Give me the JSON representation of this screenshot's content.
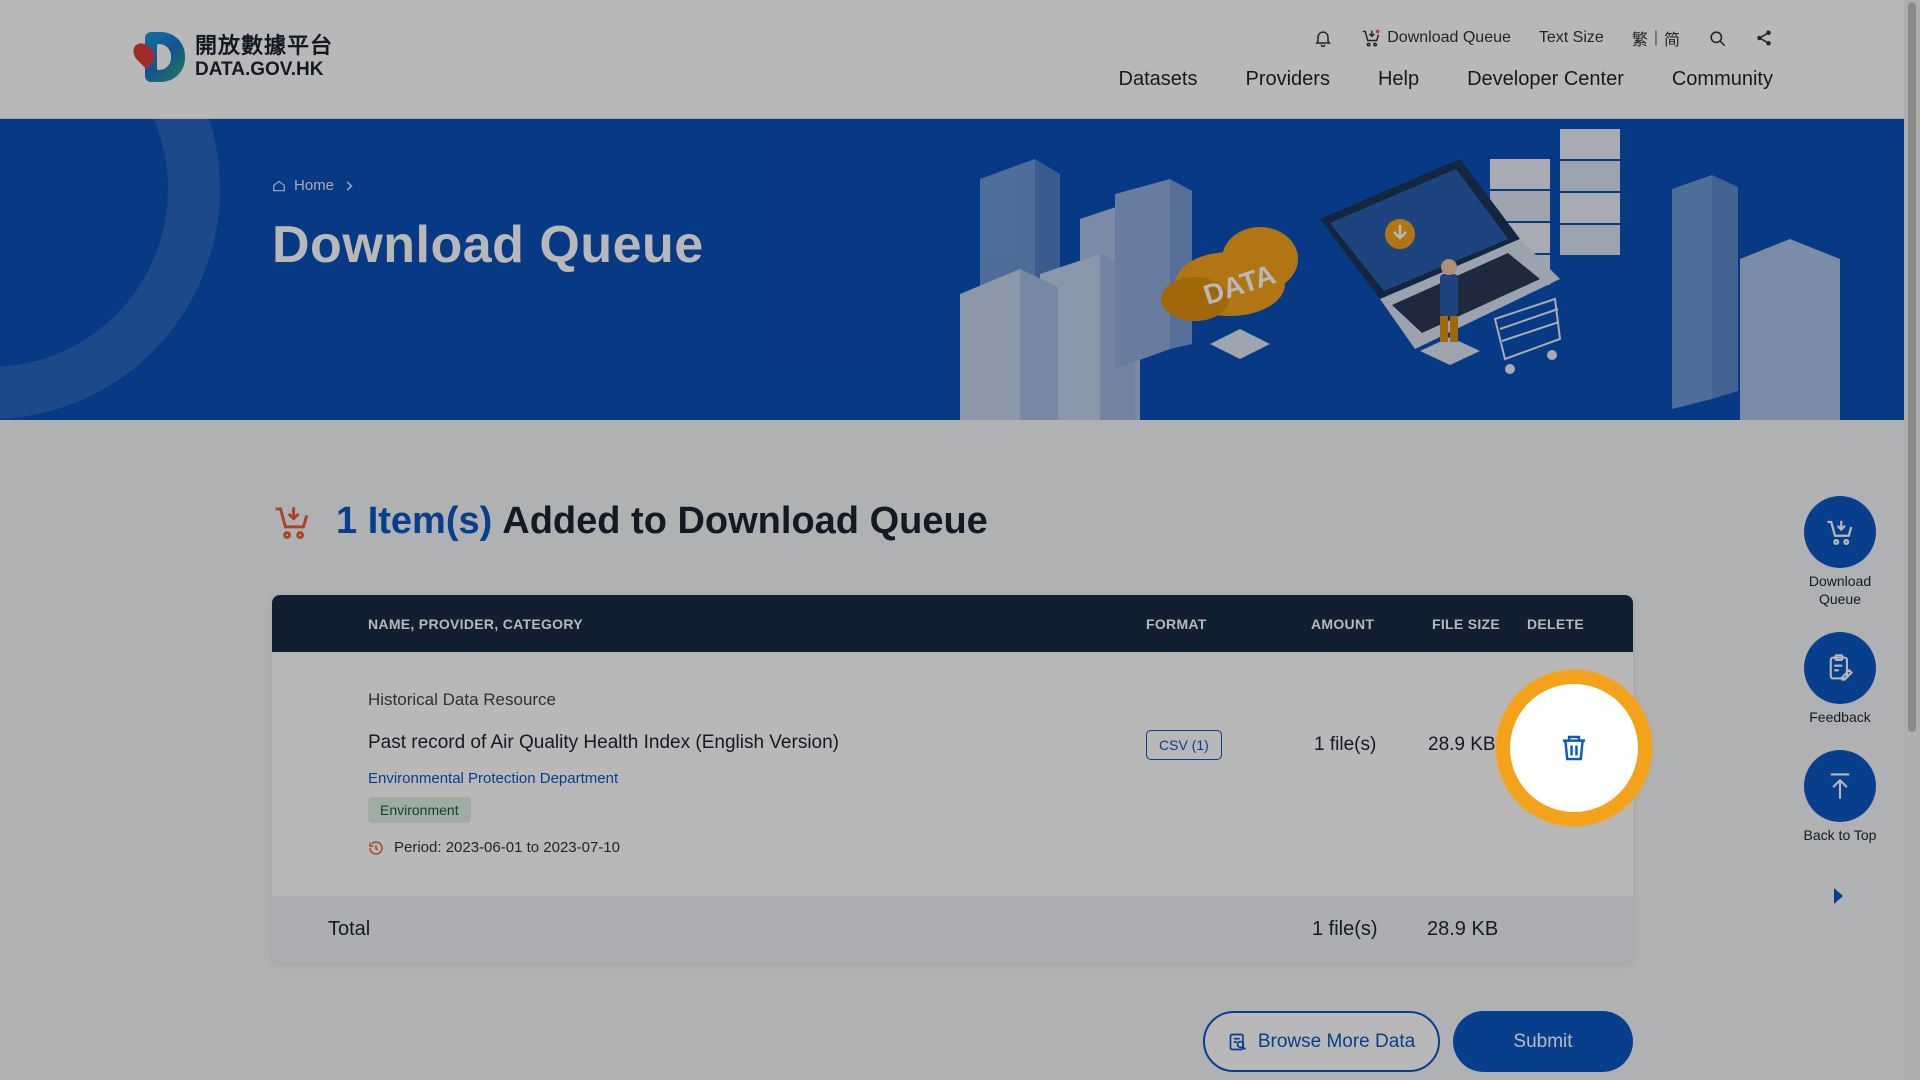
{
  "header": {
    "logo": {
      "zh": "開放數據平台",
      "en": "DATA.GOV.HK"
    },
    "utility": {
      "download_queue": "Download Queue",
      "text_size": "Text Size",
      "lang_trad": "繁",
      "lang_sep": "|",
      "lang_simp": "简"
    },
    "nav": [
      "Datasets",
      "Providers",
      "Help",
      "Developer Center",
      "Community"
    ]
  },
  "banner": {
    "breadcrumb_home": "Home",
    "title": "Download Queue",
    "illustration_text": "DATA"
  },
  "summary": {
    "count": "1 Item(s)",
    "rest": "Added to Download Queue"
  },
  "table": {
    "headers": {
      "name": "NAME, PROVIDER, CATEGORY",
      "format": "FORMAT",
      "amount": "AMOUNT",
      "file_size": "FILE SIZE",
      "delete": "DELETE"
    },
    "rows": [
      {
        "type": "Historical Data Resource",
        "name": "Past record of Air Quality Health Index (English Version)",
        "provider": "Environmental Protection Department",
        "category": "Environment",
        "period": "Period: 2023-06-01 to 2023-07-10",
        "format": "CSV (1)",
        "amount": "1 file(s)",
        "file_size": "28.9 KB"
      }
    ],
    "total": {
      "label": "Total",
      "amount": "1 file(s)",
      "file_size": "28.9 KB"
    }
  },
  "actions": {
    "browse": "Browse More Data",
    "submit": "Submit"
  },
  "side": {
    "download_queue": "Download Queue",
    "feedback": "Feedback",
    "back_to_top": "Back to Top"
  },
  "colors": {
    "primary": "#0c58c4",
    "banner": "#0c4fb8",
    "table_header": "#1a2a45",
    "highlight": "#f5a21b",
    "accent_orange": "#e8603c"
  }
}
